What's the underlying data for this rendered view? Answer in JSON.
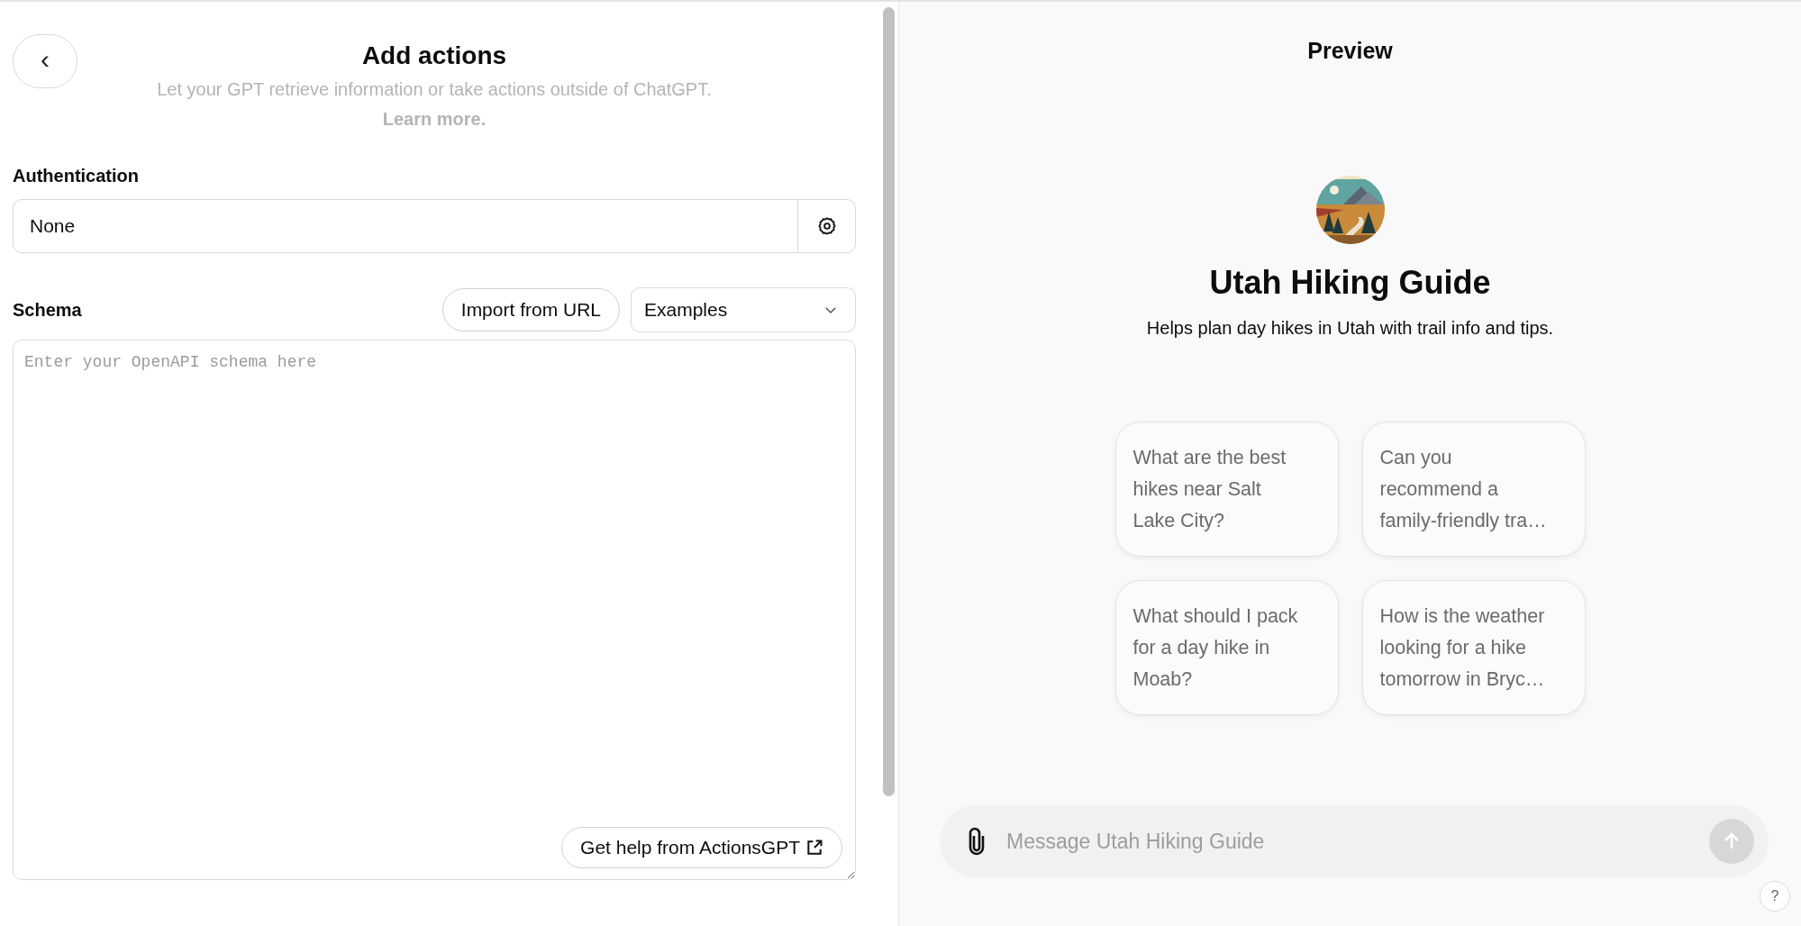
{
  "editor": {
    "back_button": "‹",
    "title": "Add actions",
    "subtitle": "Let your GPT retrieve information or take actions outside of ChatGPT.",
    "learn_more": "Learn more.",
    "authentication": {
      "label": "Authentication",
      "value": "None"
    },
    "schema": {
      "label": "Schema",
      "import_button": "Import from URL",
      "examples_select": "Examples",
      "placeholder": "Enter your OpenAPI schema here",
      "help_button": "Get help from ActionsGPT"
    }
  },
  "preview": {
    "title": "Preview",
    "gpt_name": "Utah Hiking Guide",
    "description": "Helps plan day hikes in Utah with trail info and tips.",
    "suggestions": [
      {
        "text": "What are the best hikes near Salt Lake City?"
      },
      {
        "text": "Can you recommend a family-friendly tra…"
      },
      {
        "text": "What should I pack for a day hike in Moab?"
      },
      {
        "text": "How is the weather looking for a hike tomorrow in Bryc…"
      }
    ],
    "message": {
      "placeholder": "Message Utah Hiking Guide"
    },
    "help": "?"
  }
}
